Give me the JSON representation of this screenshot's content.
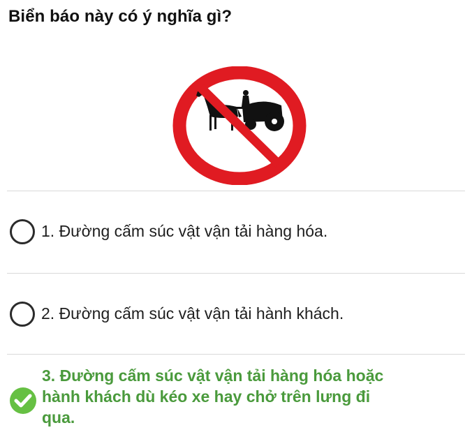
{
  "question": "Biển báo này có ý nghĩa gì?",
  "sign": {
    "icon": "no-animal-drawn-vehicles-sign-icon",
    "ring_color": "#e01b22",
    "figure_color": "#111111"
  },
  "options": [
    {
      "label": "1. Đường cấm súc vật vận tải hàng hóa.",
      "state": "unselected"
    },
    {
      "label": "2. Đường cấm súc vật vận tải hành khách.",
      "state": "unselected"
    },
    {
      "label_lines": [
        "3. Đường cấm súc vật vận tải hàng hóa hoặc",
        "hành khách dù kéo xe hay chở trên lưng đi",
        "qua."
      ],
      "state": "correct"
    }
  ],
  "colors": {
    "correct_text": "#4a9a3c",
    "check_badge": "#66c043",
    "divider": "#d9d9d9"
  }
}
